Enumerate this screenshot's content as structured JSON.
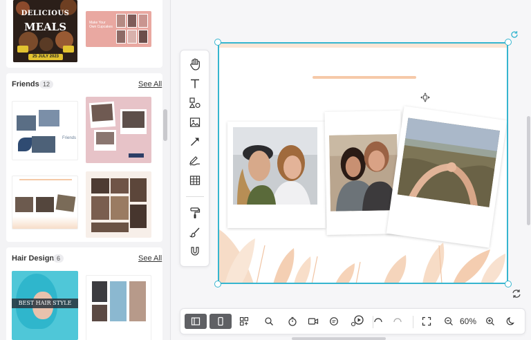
{
  "templates": {
    "top_items": [
      {
        "name": "delicious-meals",
        "title_line1": "DELICIOUS",
        "title_line2": "MEALS",
        "date": "25 JULY 2023"
      },
      {
        "name": "cupcakes",
        "text": "Make Your Own Cupcakes"
      }
    ],
    "sections": [
      {
        "title": "Friends",
        "count": "12",
        "see_all": "See All",
        "thumb_text": "Friends"
      },
      {
        "title": "Hair Design",
        "count": "6",
        "see_all": "See All",
        "thumb_title": "BEST HAIR STYLE"
      }
    ]
  },
  "zoom": "60%",
  "colors": {
    "selection": "#35b5cf",
    "active_button": "#5f6064",
    "accent_peach": "#f6c9a8"
  },
  "toolbar_icons": [
    "hand-icon",
    "text-icon",
    "shapes-icon",
    "image-icon",
    "arrow-icon",
    "draw-icon",
    "table-icon",
    "paint-roller-icon",
    "brush-icon",
    "magnet-icon"
  ],
  "bottom_icons": [
    "panel-icon",
    "page-icon",
    "grid-icon",
    "search-icon",
    "timer-icon",
    "video-icon",
    "comment-icon",
    "play-icon",
    "undo-icon",
    "redo-icon",
    "fullscreen-icon",
    "zoom-out-icon",
    "zoom-in-icon",
    "dark-mode-icon"
  ]
}
